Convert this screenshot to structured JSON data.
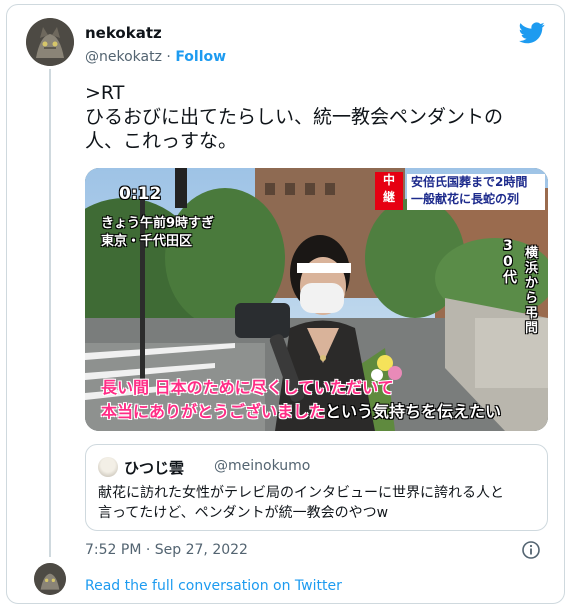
{
  "tweet": {
    "display_name": "nekokatz",
    "handle": "@nekokatz",
    "separator": "·",
    "follow_label": "Follow",
    "text_lines": [
      ">RT",
      "ひるおびに出てたらしい、統一教会ペンダントの",
      "人、これっすな。"
    ],
    "timestamp": "7:52 PM · Sep 27, 2022",
    "read_more_label": "Read the full conversation on Twitter"
  },
  "media": {
    "time_caption": "0:12",
    "date_caption": "きょう午前9時すぎ",
    "location_caption": "東京・千代田区",
    "live_badge": "中継",
    "headline_1": "安倍氏国葬まで2時間",
    "headline_2": "一般献花に長蛇の列",
    "side_caption_1": "30代",
    "side_caption_2": "横浜から弔問",
    "subtitle_1": "長い間 日本のために尽くしていただいて",
    "subtitle_2a": "本当にありがとうございました",
    "subtitle_2b": "という気持ちを伝えたい"
  },
  "quote": {
    "name": "ひつじ雲",
    "handle": "@meinokumo",
    "text_lines": [
      "献花に訪れた女性がテレビ局のインタビューに世界に誇れる人と",
      "言ってたけど、ペンダントが統一教会のやつw"
    ]
  },
  "colors": {
    "accent": "#1d9bf0",
    "border": "#cfd9de",
    "secondary_text": "#536471",
    "subtitle_pink": "#ff2d86",
    "badge_red": "#e60012"
  },
  "icons": {
    "brand": "twitter-bird-icon",
    "info": "info-icon"
  }
}
